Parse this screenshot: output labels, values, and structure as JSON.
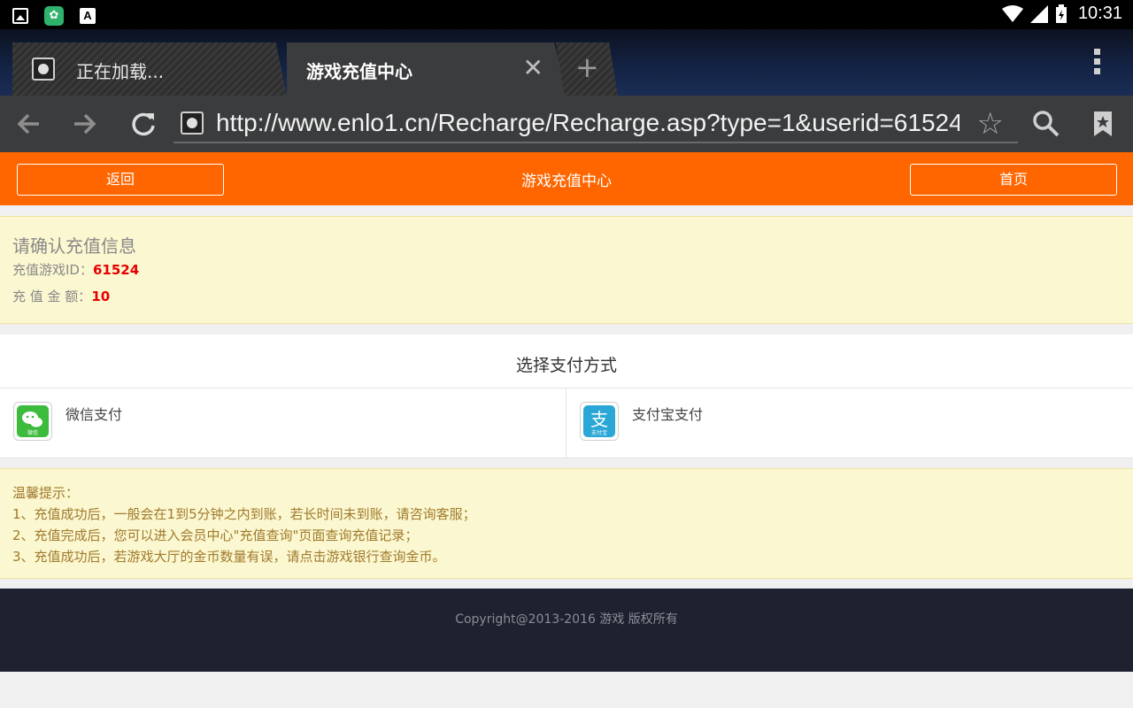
{
  "status_bar": {
    "time": "10:31",
    "left_icons": [
      "image-icon",
      "app-icon",
      "font-icon"
    ],
    "right_icons": [
      "wifi-icon",
      "signal-icon",
      "battery-charging-icon"
    ]
  },
  "browser": {
    "tabs": [
      {
        "label": "正在加载...",
        "active": false
      },
      {
        "label": "游戏充值中心",
        "active": true
      }
    ],
    "url": "http://www.enlo1.cn/Recharge/Recharge.asp?type=1&userid=61524"
  },
  "header": {
    "back_label": "返回",
    "title": "游戏充值中心",
    "home_label": "首页",
    "accent_color": "#ff6600"
  },
  "confirm": {
    "title": "请确认充值信息",
    "game_id_label": "充值游戏ID：",
    "game_id_value": "61524",
    "amount_label": "充 值 金 额：",
    "amount_value": "10"
  },
  "payment": {
    "title": "选择支付方式",
    "options": [
      {
        "label": "微信支付",
        "icon": "wechat-pay-icon",
        "icon_text": "微信"
      },
      {
        "label": "支付宝支付",
        "icon": "alipay-icon",
        "icon_text": "支付宝"
      }
    ]
  },
  "notice": {
    "heading": "温馨提示：",
    "lines": [
      "1、充值成功后，一般会在1到5分钟之内到账，若长时间未到账，请咨询客服；",
      "2、充值完成后，您可以进入会员中心\"充值查询\"页面查询充值记录；",
      "3、充值成功后，若游戏大厅的金币数量有误，请点击游戏银行查询金币。"
    ]
  },
  "footer": {
    "copyright": "Copyright@2013-2016 游戏 版权所有"
  }
}
